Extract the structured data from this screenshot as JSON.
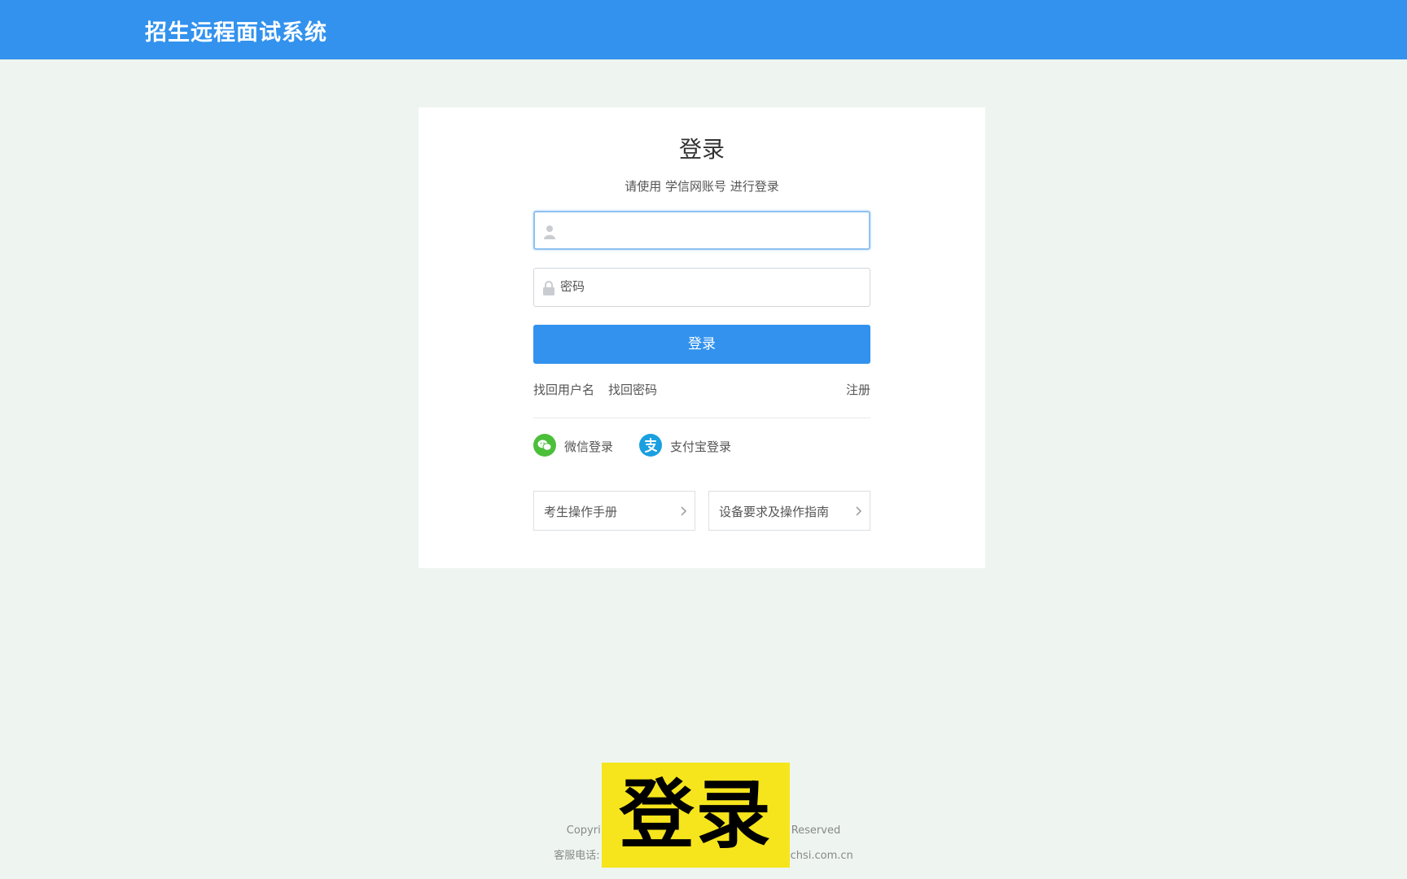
{
  "header": {
    "title": "招生远程面试系统"
  },
  "login": {
    "title": "登录",
    "subtitle": "请使用 学信网账号 进行登录",
    "username": {
      "value": "",
      "placeholder": "",
      "icon": "user-icon"
    },
    "password": {
      "value": "",
      "placeholder": "密码",
      "icon": "lock-icon"
    },
    "submit_label": "登录",
    "links": {
      "recover_username": "找回用户名",
      "recover_password": "找回密码",
      "register": "注册"
    },
    "social": [
      {
        "label": "微信登录",
        "icon": "wechat-icon",
        "color": "#4cbf3a"
      },
      {
        "label": "支付宝登录",
        "icon": "alipay-icon",
        "color": "#1aa0e0"
      }
    ],
    "guides": [
      {
        "label": "考生操作手册",
        "icon": "chevron-right-icon"
      },
      {
        "label": "设备要求及操作指南",
        "icon": "chevron-right-icon"
      }
    ]
  },
  "footer": {
    "line1_left": "Copyri",
    "line1_right": "Reserved",
    "line2_left": "客服电话:",
    "line2_right": "chsi.com.cn"
  },
  "overlay": {
    "text": "登录"
  },
  "colors": {
    "primary": "#3292ee",
    "background": "#eef5f0",
    "overlay": "#f6e51c"
  }
}
